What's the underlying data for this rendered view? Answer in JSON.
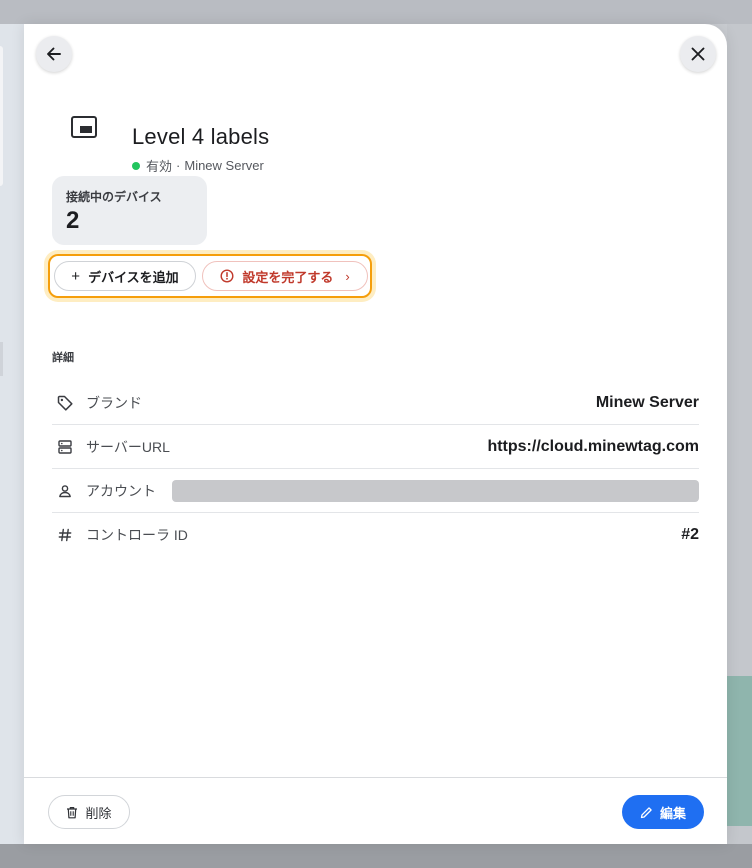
{
  "header": {
    "title": "Level 4 labels",
    "status_text": "有効",
    "status_separator": "·",
    "server_name": "Minew Server",
    "status_color": "#22c55e"
  },
  "stats": {
    "connected_label": "接続中のデバイス",
    "connected_value": "2"
  },
  "actions": {
    "add_device_label": "デバイスを追加",
    "finish_setup_label": "設定を完了する",
    "highlight_color": "#f59e0b"
  },
  "details": {
    "section_label": "詳細",
    "rows": [
      {
        "icon": "tag-icon",
        "label": "ブランド",
        "value": "Minew Server"
      },
      {
        "icon": "server-icon",
        "label": "サーバーURL",
        "value": "https://cloud.minewtag.com"
      },
      {
        "icon": "user-icon",
        "label": "アカウント",
        "value": ""
      },
      {
        "icon": "hash-icon",
        "label": "コントローラ ID",
        "value": "#2"
      }
    ]
  },
  "footer": {
    "delete_label": "削除",
    "edit_label": "編集",
    "edit_color": "#1f6ff2"
  }
}
